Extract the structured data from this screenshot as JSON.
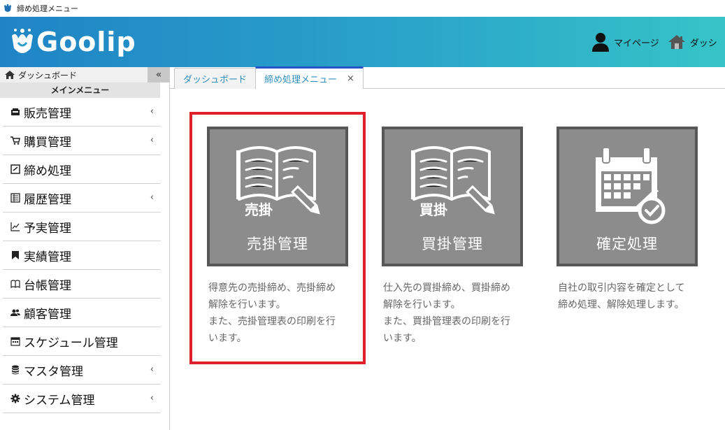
{
  "window": {
    "title": "締め処理メニュー"
  },
  "header": {
    "logo_text": "Goolip",
    "nav": [
      {
        "label": "マイページ",
        "icon": "user-icon"
      },
      {
        "label": "ダッシ",
        "icon": "home-icon"
      }
    ]
  },
  "sidebar": {
    "dashboard_label": "ダッシュボード",
    "collapse_label": "«",
    "section_title": "メインメニュー",
    "items": [
      {
        "label": "販売管理",
        "icon": "register-icon",
        "has_submenu": true
      },
      {
        "label": "購買管理",
        "icon": "cart-icon",
        "has_submenu": true
      },
      {
        "label": "締め処理",
        "icon": "checkbox-icon",
        "has_submenu": false
      },
      {
        "label": "履歴管理",
        "icon": "ledger-icon",
        "has_submenu": true
      },
      {
        "label": "予実管理",
        "icon": "line-chart-icon",
        "has_submenu": false
      },
      {
        "label": "実績管理",
        "icon": "bookmark-icon",
        "has_submenu": false
      },
      {
        "label": "台帳管理",
        "icon": "open-book-icon",
        "has_submenu": false
      },
      {
        "label": "顧客管理",
        "icon": "users-icon",
        "has_submenu": false
      },
      {
        "label": "スケジュール管理",
        "icon": "calendar-icon",
        "has_submenu": false
      },
      {
        "label": "マスタ管理",
        "icon": "database-icon",
        "has_submenu": true
      },
      {
        "label": "システム管理",
        "icon": "gear-icon",
        "has_submenu": true
      }
    ],
    "submenu_glyph": "‹"
  },
  "tabs": [
    {
      "label": "ダッシュボード",
      "active": false
    },
    {
      "label": "締め処理メニュー",
      "active": true,
      "close": "×"
    }
  ],
  "cards": [
    {
      "title": "売掛管理",
      "icon_label": "売掛",
      "icon": "book-pencil-icon",
      "description": [
        "得意先の売掛締め、売掛締め",
        "解除を行います。",
        "また、売掛管理表の印刷を行",
        "います。"
      ]
    },
    {
      "title": "買掛管理",
      "icon_label": "買掛",
      "icon": "book-pencil-icon",
      "description": [
        "仕入先の買掛締め、買掛締め",
        "解除を行います。",
        "また、買掛管理表の印刷を行",
        "います。"
      ]
    },
    {
      "title": "確定処理",
      "icon_label": "",
      "icon": "calendar-check-icon",
      "description": [
        "自社の取引内容を確定として",
        "締め処理、解除処理します。"
      ]
    }
  ],
  "colors": {
    "header_start": "#1f84c6",
    "header_end": "#36c4c8",
    "card_bg": "#8c8c8c",
    "card_border": "#575757",
    "highlight": "#e0202a",
    "tab_active_top": "#2357c8"
  }
}
